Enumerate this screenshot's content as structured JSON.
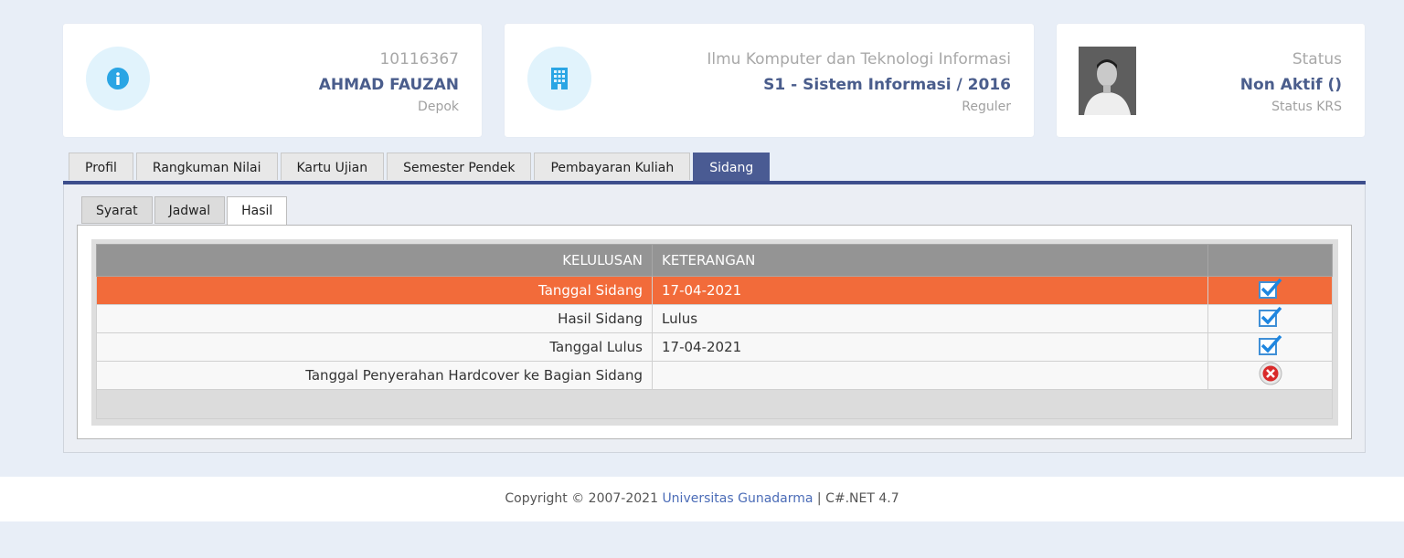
{
  "student": {
    "nim": "10116367",
    "name": "AHMAD FAUZAN",
    "campus": "Depok"
  },
  "faculty": {
    "name": "Ilmu Komputer dan Teknologi Informasi",
    "program": "S1 - Sistem Informasi / 2016",
    "class_type": "Reguler"
  },
  "status": {
    "label": "Status",
    "value": "Non Aktif ()",
    "sub": "Status KRS"
  },
  "tabs": [
    "Profil",
    "Rangkuman Nilai",
    "Kartu Ujian",
    "Semester Pendek",
    "Pembayaran Kuliah",
    "Sidang"
  ],
  "subtabs": [
    "Syarat",
    "Jadwal",
    "Hasil"
  ],
  "table": {
    "headers": [
      "KELULUSAN",
      "KETERANGAN",
      ""
    ],
    "rows": [
      {
        "label": "Tanggal Sidang",
        "value": "17-04-2021",
        "status_icon": "check-icon"
      },
      {
        "label": "Hasil Sidang",
        "value": "Lulus",
        "status_icon": "check-icon"
      },
      {
        "label": "Tanggal Lulus",
        "value": "17-04-2021",
        "status_icon": "check-icon"
      },
      {
        "label": "Tanggal Penyerahan Hardcover ke Bagian Sidang",
        "value": "",
        "status_icon": "cross-icon"
      }
    ]
  },
  "footer": {
    "prefix": "Copyright © 2007-2021 ",
    "link": "Universitas Gunadarma",
    "suffix": " | C#.NET 4.7"
  },
  "colors": {
    "accent": "#4a5b93",
    "selected_row": "#f26b3a",
    "icon_circle": "#e1f3fc",
    "icon": "#2aa5e4"
  }
}
